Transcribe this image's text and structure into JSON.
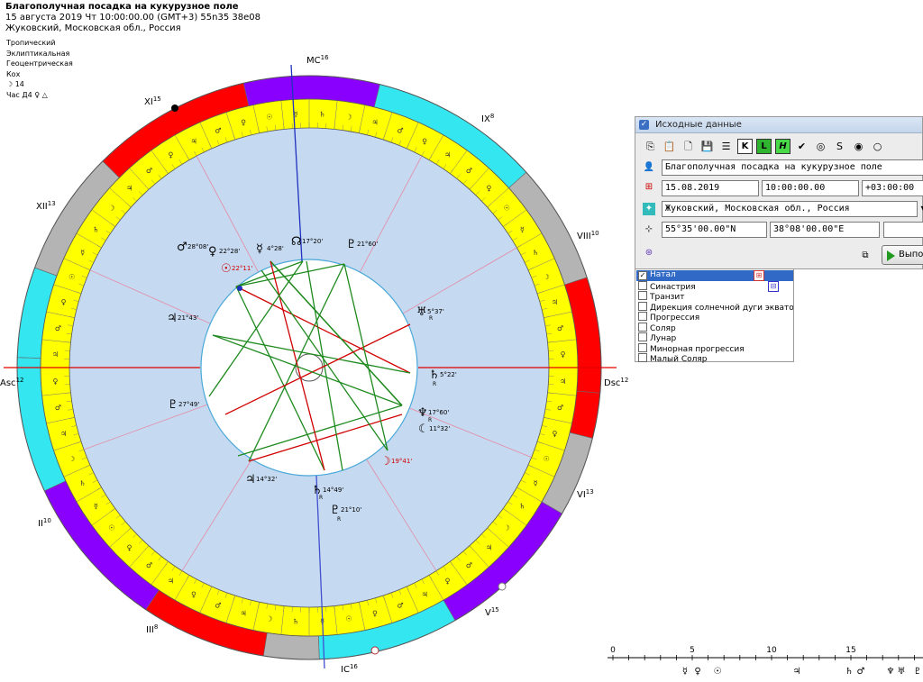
{
  "header": {
    "title": "Благополучная посадка на кукурузное поле",
    "line2": "15 августа 2019  Чт  10:00:00.00 (GMT+3) 55n35  38e08",
    "line3": "Жуковский, Московская обл., Россия"
  },
  "system": [
    "Тропический",
    "Эклиптикальная",
    "Геоцентрическая",
    "Кох"
  ],
  "moon_line": "☽  14",
  "hour_line": "Час Д4  ♀  △",
  "cusps": {
    "mc": "MC",
    "mc_deg": "16",
    "ic": "IC",
    "ic_deg": "16",
    "asc": "Asc",
    "asc_deg": "12",
    "dsc": "Dsc",
    "dsc_deg": "12",
    "xi": "XI",
    "xi_deg": "15",
    "xii": "XII",
    "xii_deg": "13",
    "ix": "IX",
    "ix_deg": "8",
    "viii": "VIII",
    "viii_deg": "10",
    "ii": "II",
    "ii_deg": "10",
    "iii": "III",
    "iii_deg": "8",
    "vi": "VI",
    "vi_deg": "13",
    "v": "V",
    "v_deg": "15"
  },
  "planets": [
    {
      "glyph": "♂",
      "deg": "28°08'",
      "color": "#000"
    },
    {
      "glyph": "♀",
      "deg": "22°28'",
      "color": "#000"
    },
    {
      "glyph": "☉",
      "deg": "22°11'",
      "color": "#d00000"
    },
    {
      "glyph": "☿",
      "deg": "4°28'",
      "color": "#000"
    },
    {
      "glyph": "☊",
      "deg": "17°20'",
      "color": "#000"
    },
    {
      "glyph": "♇",
      "deg": "21°60'",
      "color": "#000"
    },
    {
      "glyph": "♅",
      "deg": "5°37'",
      "color": "#000"
    },
    {
      "glyph": "♄",
      "deg": "5°22'",
      "color": "#000"
    },
    {
      "glyph": "♆",
      "deg": "17°60'",
      "color": "#000"
    },
    {
      "glyph": "☾",
      "deg": "11°32'",
      "color": "#000"
    },
    {
      "glyph": "☽",
      "deg": "19°41'",
      "color": "#d00000"
    },
    {
      "glyph": "♃",
      "deg": "14°32'",
      "color": "#000"
    },
    {
      "glyph": "♄",
      "deg": "14°49'",
      "color": "#000"
    },
    {
      "glyph": "♇",
      "deg": "21°10'",
      "color": "#000"
    },
    {
      "glyph": "♃",
      "deg": "21°43'",
      "color": "#000"
    },
    {
      "glyph": "♇",
      "deg": "27°49'",
      "color": "#000"
    }
  ],
  "retro": "R",
  "panel": {
    "title": "Исходные данные",
    "name": "Благополучная посадка на кукурузное поле",
    "date": "15.08.2019",
    "time": "10:00:00.00",
    "tz": "+03:00:00",
    "place": "Жуковский, Московская обл., Россия",
    "lat": "55°35'00.00\"N",
    "lon": "38°08'00.00\"E",
    "run": "Выпол"
  },
  "chart_types": [
    "Натал",
    "Синастрия",
    "Транзит",
    "Дирекция солнечной дуги экватори",
    "Прогрессия",
    "Соляр",
    "Лунар",
    "Минорная прогрессия",
    "Малый Соляр"
  ],
  "scale": {
    "ticks": [
      "0",
      "5",
      "10",
      "15"
    ]
  },
  "colors": {
    "yellow": "#ffff00",
    "red": "#ff0000",
    "purple": "#8a00ff",
    "cyan": "#33e6f0",
    "gray": "#b4b4b4",
    "bg": "#c5d9f0"
  }
}
